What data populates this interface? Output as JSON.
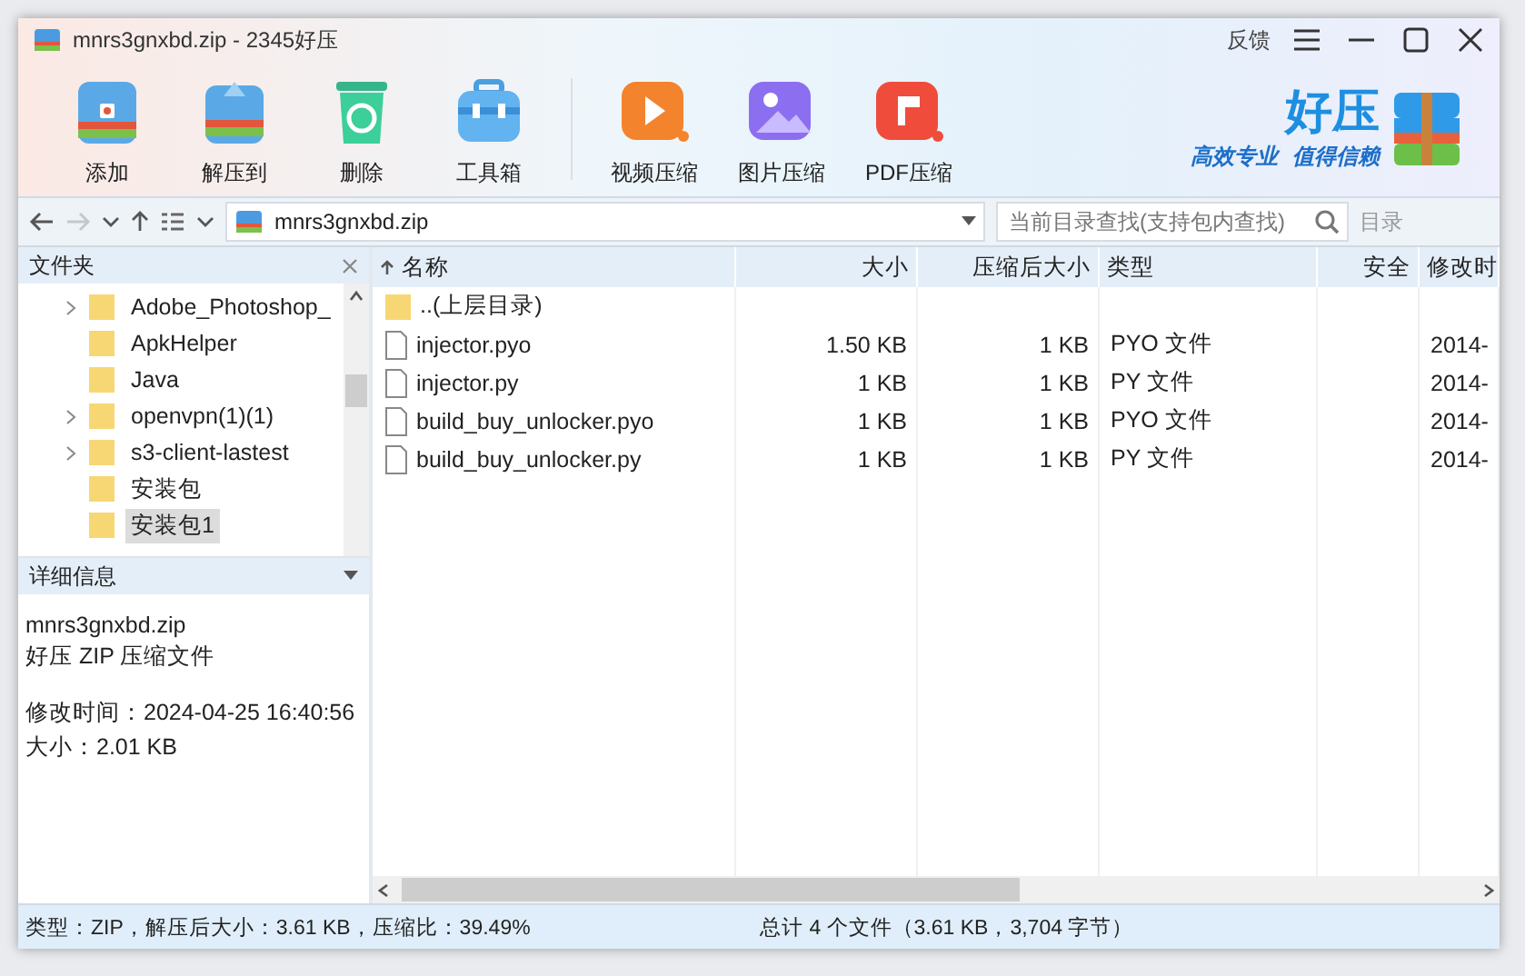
{
  "window": {
    "title": "mnrs3gnxbd.zip - 2345好压",
    "feedback": "反馈",
    "controls": [
      {
        "kind": "menu"
      },
      {
        "kind": "minimize"
      },
      {
        "kind": "maximize"
      },
      {
        "kind": "close"
      }
    ]
  },
  "toolbar": {
    "main": [
      {
        "kind": "add",
        "label": "添加"
      },
      {
        "kind": "extract",
        "label": "解压到"
      },
      {
        "kind": "delete",
        "label": "删除"
      },
      {
        "kind": "toolbox",
        "label": "工具箱"
      }
    ],
    "compress": [
      {
        "kind": "video",
        "label": "视频压缩"
      },
      {
        "kind": "image",
        "label": "图片压缩"
      },
      {
        "kind": "pdf",
        "label": "PDF压缩"
      }
    ]
  },
  "logo": {
    "name": "好压",
    "slogan": [
      "高效专业",
      "值得信赖"
    ]
  },
  "address_bar": {
    "back_enabled": true,
    "forward_enabled": false,
    "path": "mnrs3gnxbd.zip"
  },
  "search": {
    "placeholder": "当前目录查找(支持包内查找)",
    "button": "目录"
  },
  "folders": {
    "title": "文件夹",
    "items": [
      {
        "label": "Adobe_Photoshop_",
        "expandable": true,
        "selected": false
      },
      {
        "label": "ApkHelper",
        "expandable": false,
        "selected": false
      },
      {
        "label": "Java",
        "expandable": false,
        "selected": false
      },
      {
        "label": "openvpn(1)(1)",
        "expandable": true,
        "selected": false
      },
      {
        "label": "s3-client-lastest",
        "expandable": true,
        "selected": false
      },
      {
        "label": "安装包",
        "expandable": false,
        "selected": false
      },
      {
        "label": "安装包1",
        "expandable": false,
        "selected": true
      }
    ]
  },
  "details": {
    "title": "详细信息",
    "groups": [
      [
        "mnrs3gnxbd.zip",
        "好压 ZIP 压缩文件"
      ],
      [
        "修改时间：2024-04-25 16:40:56",
        "大小：2.01 KB"
      ]
    ]
  },
  "table": {
    "columns": [
      {
        "label": "名称",
        "sorted": true
      },
      {
        "label": "大小",
        "sorted": false
      },
      {
        "label": "压缩后大小",
        "sorted": false
      },
      {
        "label": "类型",
        "sorted": false
      },
      {
        "label": "安全",
        "sorted": false
      },
      {
        "label": "修改时",
        "sorted": false
      }
    ],
    "rows": [
      {
        "kind": "parent",
        "cells": [
          "..(上层目录)"
        ]
      },
      {
        "kind": "file",
        "cells": [
          "injector.pyo",
          "1.50 KB",
          "1 KB",
          "PYO 文件",
          null,
          "2014-"
        ]
      },
      {
        "kind": "file",
        "cells": [
          "injector.py",
          "1 KB",
          "1 KB",
          "PY 文件",
          null,
          "2014-"
        ]
      },
      {
        "kind": "file",
        "cells": [
          "build_buy_unlocker.pyo",
          "1 KB",
          "1 KB",
          "PYO 文件",
          null,
          "2014-"
        ]
      },
      {
        "kind": "file",
        "cells": [
          "build_buy_unlocker.py",
          "1 KB",
          "1 KB",
          "PY 文件",
          null,
          "2014-"
        ]
      }
    ]
  },
  "status_bar": {
    "left": "类型：ZIP，解压后大小：3.61 KB，压缩比：39.49%",
    "right": "总计 4 个文件（3.61 KB，3,704 字节）"
  }
}
